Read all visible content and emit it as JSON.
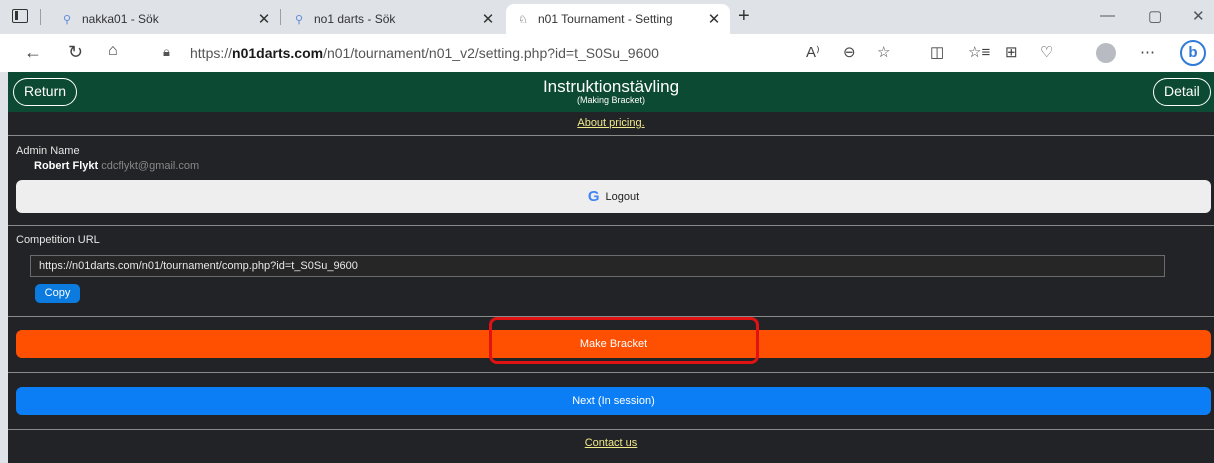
{
  "browser": {
    "tabs": [
      {
        "label": "nakka01 - Sök",
        "active": false
      },
      {
        "label": "no1 darts - Sök",
        "active": false
      },
      {
        "label": "n01 Tournament - Setting",
        "active": true
      }
    ],
    "url_prefix": "https://",
    "url_domain": "n01darts.com",
    "url_path": "/n01/tournament/n01_v2/setting.php?id=t_S0Su_9600",
    "reader_icon": "A⁾",
    "window_controls": [
      "—",
      "▢",
      "✕"
    ]
  },
  "header": {
    "return_label": "Return",
    "title": "Instruktionstävling",
    "subtitle": "(Making Bracket)",
    "detail_label": "Detail"
  },
  "content": {
    "pricing_link": "About pricing.",
    "admin_label": "Admin Name",
    "admin_name": "Robert Flykt",
    "admin_email": "cdcflykt@gmail.com",
    "logout_label": "Logout",
    "competition_url_label": "Competition URL",
    "competition_url": "https://n01darts.com/n01/tournament/comp.php?id=t_S0Su_9600",
    "copy_label": "Copy",
    "make_bracket_label": "Make Bracket",
    "next_label": "Next (In session)",
    "contact_link": "Contact us"
  },
  "colors": {
    "header_bg": "#0c4a33",
    "page_bg": "#222326",
    "make_bracket": "#ff4f00",
    "next_button": "#0b7ef5",
    "highlight": "#e01212"
  }
}
